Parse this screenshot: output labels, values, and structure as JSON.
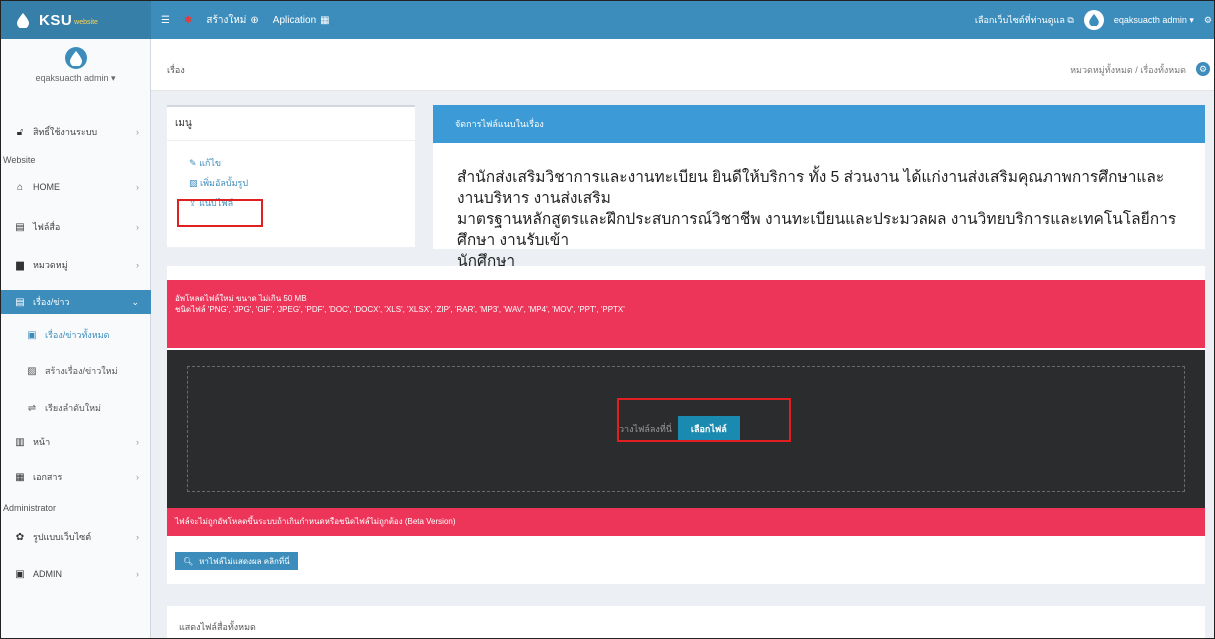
{
  "colors": {
    "primary": "#3c8dbc",
    "danger": "#ec3559",
    "dark": "#2a2c2d",
    "header_blue": "#3c9ad6"
  },
  "topbar": {
    "brand": "KSU",
    "brand_sub": "website",
    "menu_icon": "hamburger-icon",
    "create_label": "สร้างใหม่",
    "app_label": "Aplication",
    "site_link": "เลือกเว็บไซต์ที่ท่านดูแล",
    "user": "eqaksuacth admin"
  },
  "sidebar": {
    "user": "eqaksuacth admin",
    "items": [
      {
        "label": "สิทธิ์ใช้งานระบบ",
        "icon": "lock-icon"
      },
      {
        "label": "HOME",
        "icon": "home-icon"
      },
      {
        "label": "ไฟล์สื่อ",
        "icon": "media-icon"
      },
      {
        "label": "หมวดหมู่",
        "icon": "category-icon"
      },
      {
        "label": "เรื่อง/ข่าว",
        "icon": "news-icon"
      },
      {
        "label": "หน้า",
        "icon": "page-icon"
      },
      {
        "label": "เอกสาร",
        "icon": "document-icon"
      },
      {
        "label": "รูปแบบเว็บไซต์",
        "icon": "palette-icon"
      },
      {
        "label": "ADMIN",
        "icon": "admin-icon"
      }
    ],
    "headers": {
      "website": "Website",
      "administrator": "Administrator"
    },
    "subitems": [
      {
        "label": "เรื่อง/ข่าวทั้งหมด",
        "icon": "list-icon"
      },
      {
        "label": "สร้างเรื่อง/ข่าวใหม่",
        "icon": "add-icon"
      },
      {
        "label": "เรียงลำดับใหม่",
        "icon": "sort-icon"
      }
    ]
  },
  "breadcrumb": {
    "page_title": "เรื่อง",
    "trail": "หมวดหมู่ทั้งหมด / เรื่องทั้งหมด"
  },
  "menu": {
    "title": "เมนู",
    "links": [
      "แก้ไข",
      "เพิ่มอัลบั้มรูป",
      "แนบไฟล์"
    ]
  },
  "attach": {
    "title": "จัดการไฟล์แนบในเรื่อง",
    "line1": "สำนักส่งเสริมวิชาการและงานทะเบียน ยินดีให้บริการ ทั้ง 5 ส่วนงาน ได้แก่งานส่งเสริมคุณภาพการศึกษาและงานบริหาร งานส่งเสริม",
    "line2": "มาตรฐานหลักสูตรและฝึกประสบการณ์วิชาชีพ งานทะเบียนและประมวลผล งานวิทยบริการและเทคโนโลยีการศึกษา งานรับเข้า",
    "line3": "นักศึกษา"
  },
  "upload": {
    "info_line1": "อัพโหลดไฟล์ใหม่ ขนาด ไม่เกิน 50 MB",
    "info_line2": "ชนิดไฟล์ 'PNG', 'JPG', 'GIF', 'JPEG', 'PDF', 'DOC', 'DOCX', 'XLS', 'XLSX', 'ZIP', 'RAR', 'MP3', 'WAV', 'MP4', 'MOV', 'PPT', 'PPTX'",
    "drop_text": "วางไฟล์ลงที่นี่",
    "choose_button": "เลือกไฟล์",
    "error_text": "ไฟล์จะไม่ถูกอัพโหลดขึ้นระบบถ้าเกินกำหนดหรือชนิดไฟล์ไม่ถูกต้อง (Beta Version)",
    "search_button": "หาไฟล์ไม่แสดงผล คลิกที่นี่"
  },
  "files": {
    "title": "แสดงไฟล์สื่อทั้งหมด"
  }
}
